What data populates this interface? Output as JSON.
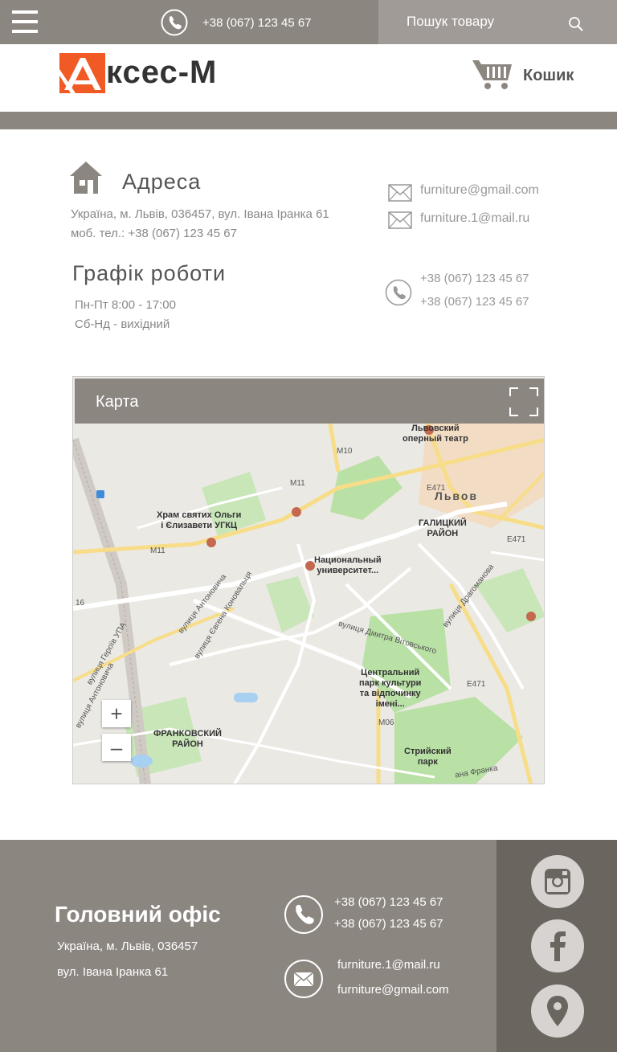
{
  "topbar": {
    "phone": "+38 (067) 123 45 67",
    "search_placeholder": "Пошук товару"
  },
  "header": {
    "logo_text": "ксес-М",
    "cart_label": "Кошик"
  },
  "contacts": {
    "address_title": "Адреса",
    "address_line1": "Україна, м. Львів, 036457, вул. Івана Іранка 61",
    "address_line2": "моб. тел.: +38 (067) 123 45 67",
    "schedule_title": "Графік роботи",
    "schedule_line1": "Пн-Пт 8:00 - 17:00",
    "schedule_line2": "Сб-Нд - вихідний",
    "emails": [
      "furniture@gmail.com",
      "furniture.1@mail.ru"
    ],
    "phones": [
      "+38 (067) 123 45 67",
      "+38 (067) 123 45 67"
    ]
  },
  "map": {
    "title": "Карта",
    "zoom_in": "+",
    "zoom_out": "–",
    "labels": {
      "opera": "Львовский\nоперный театр",
      "lviv": "Львов",
      "galician": "ГАЛИЦКИЙ\nРАЙОН",
      "church": "Храм святих Ольги\nі Єлизавети УГКЦ",
      "university": "Национальный\nуниверситет...",
      "park": "Центральний\nпарк культури\nта відпочинку\nімені...",
      "frankivsk": "ФРАНКОВСКИЙ\nРАЙОН",
      "stryi": "Стрийский\nпарк",
      "m10": "M10",
      "m11a": "M11",
      "m11b": "M11",
      "e471a": "E471",
      "e471b": "E471",
      "e471c": "E471",
      "m06": "M06",
      "n16": "16",
      "st_antonovych": "вулиця Антоновича",
      "st_konovalets": "вулиця Євгена Коновальця",
      "st_heroiv": "вулиця Героїв УПА",
      "st_vitovskoho": "вулиця Дмитра Вітовського",
      "st_drahomanova": "вулиця Драгоманова",
      "st_franka": "ана Франка",
      "st_antonovych2": "вулиця Антоновича"
    }
  },
  "footer": {
    "title": "Головний офіс",
    "addr1": "Україна, м. Львів, 036457",
    "addr2": "вул. Івана Іранка 61",
    "phones": [
      "+38 (067) 123 45 67",
      "+38 (067) 123 45 67"
    ],
    "emails": [
      "furniture.1@mail.ru",
      "furniture@gmail.com"
    ]
  },
  "colors": {
    "bar": "#8c8681",
    "brand": "#f15a24",
    "footer_side": "#6b6560"
  }
}
